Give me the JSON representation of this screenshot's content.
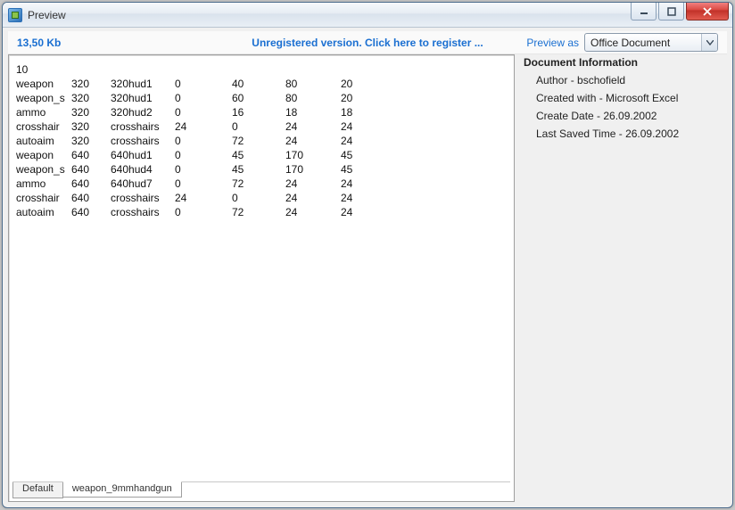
{
  "window": {
    "title": "Preview"
  },
  "infobar": {
    "filesize": "13,50 Kb",
    "register_text": "Unregistered version. Click here to register ...",
    "preview_as_label": "Preview as",
    "preview_as_value": "Office Document"
  },
  "data": {
    "header_value": "10",
    "rows": [
      {
        "c0": "weapon",
        "c1": "320",
        "c2": "320hud1",
        "c3": "0",
        "c4": "40",
        "c5": "80",
        "c6": "20"
      },
      {
        "c0": "weapon_s",
        "c1": "320",
        "c2": "320hud1",
        "c3": "0",
        "c4": "60",
        "c5": "80",
        "c6": "20"
      },
      {
        "c0": "ammo",
        "c1": "320",
        "c2": "320hud2",
        "c3": "0",
        "c4": "16",
        "c5": "18",
        "c6": "18"
      },
      {
        "c0": "crosshair",
        "c1": "320",
        "c2": "crosshairs",
        "c3": "24",
        "c4": "0",
        "c5": "24",
        "c6": "24"
      },
      {
        "c0": "autoaim",
        "c1": "320",
        "c2": "crosshairs",
        "c3": "0",
        "c4": "72",
        "c5": "24",
        "c6": "24"
      },
      {
        "c0": "weapon",
        "c1": "640",
        "c2": "640hud1",
        "c3": "0",
        "c4": "45",
        "c5": "170",
        "c6": "45"
      },
      {
        "c0": "weapon_s",
        "c1": "640",
        "c2": "640hud4",
        "c3": "0",
        "c4": "45",
        "c5": "170",
        "c6": "45"
      },
      {
        "c0": "ammo",
        "c1": "640",
        "c2": "640hud7",
        "c3": "0",
        "c4": "72",
        "c5": "24",
        "c6": "24"
      },
      {
        "c0": "crosshair",
        "c1": "640",
        "c2": "crosshairs",
        "c3": "24",
        "c4": "0",
        "c5": "24",
        "c6": "24"
      },
      {
        "c0": "autoaim",
        "c1": "640",
        "c2": "crosshairs",
        "c3": "0",
        "c4": "72",
        "c5": "24",
        "c6": "24"
      }
    ]
  },
  "sheets": {
    "tabs": [
      "Default",
      "weapon_9mmhandgun"
    ],
    "active_index": 1
  },
  "docinfo": {
    "heading": "Document Information",
    "author_label": "Author",
    "author_value": "bschofield",
    "created_with_label": "Created with",
    "created_with_value": "Microsoft Excel",
    "create_date_label": "Create Date",
    "create_date_value": "26.09.2002",
    "last_saved_label": "Last Saved Time",
    "last_saved_value": "26.09.2002"
  }
}
